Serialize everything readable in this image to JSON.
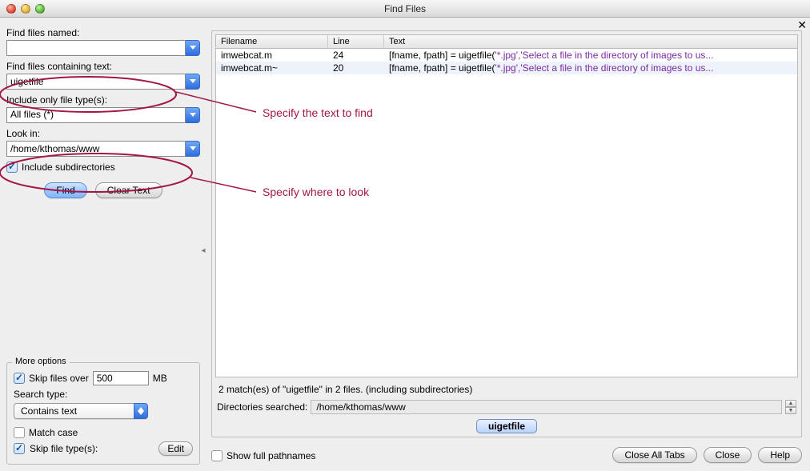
{
  "accent_blue": "#3a77e0",
  "annotation_color": "#a31648",
  "window": {
    "title": "Find Files"
  },
  "left": {
    "named_label": "Find files named:",
    "named_value": "",
    "contain_label": "Find files containing text:",
    "contain_value": "uigetfile",
    "type_label": "Include only file type(s):",
    "type_value": "All files (*)",
    "lookin_label": "Look in:",
    "lookin_value": "/home/kthomas/www",
    "include_sub_label": "Include subdirectories",
    "find_btn": "Find",
    "clear_btn": "Clear Text"
  },
  "more": {
    "legend": "More options",
    "skip_over_label": "Skip files over",
    "skip_over_value": "500",
    "skip_over_unit": "MB",
    "search_type_label": "Search type:",
    "search_type_value": "Contains text",
    "match_case_label": "Match case",
    "skip_types_label": "Skip file type(s):",
    "edit_btn": "Edit"
  },
  "results": {
    "headers": {
      "filename": "Filename",
      "line": "Line",
      "text": "Text"
    },
    "rows": [
      {
        "filename": "imwebcat.m",
        "line": "24",
        "prefix": "[fname, fpath] = uigetfile(",
        "str": "'*.jpg','Select a file in the directory of images to us..."
      },
      {
        "filename": "imwebcat.m~",
        "line": "20",
        "prefix": "[fname, fpath] = uigetfile(",
        "str": "'*.jpg','Select a file in the directory of images to us..."
      }
    ],
    "summary": "2 match(es) of \"uigetfile\" in 2 files. (including subdirectories)",
    "dir_label": "Directories searched:",
    "dir_value": "/home/kthomas/www",
    "tab": "uigetfile"
  },
  "bottom": {
    "show_paths": "Show full pathnames",
    "close_all": "Close All Tabs",
    "close": "Close",
    "help": "Help"
  },
  "annotations": {
    "text1": "Specify the text to find",
    "text2": "Specify where to look"
  }
}
